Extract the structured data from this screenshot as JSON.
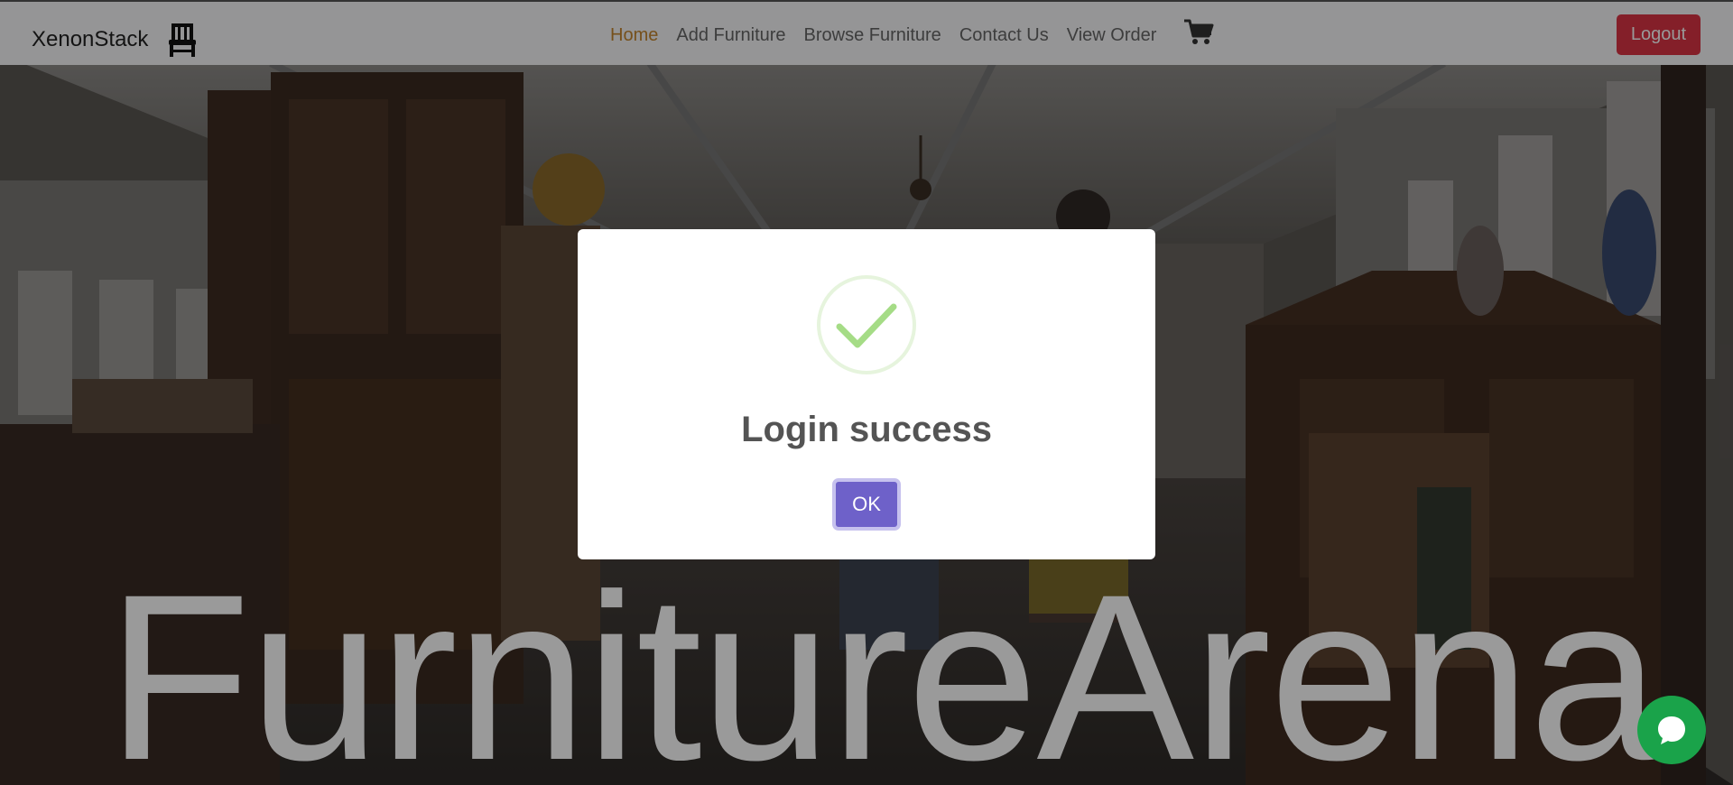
{
  "navbar": {
    "brand": "XenonStack",
    "brand_icon": "chair-icon",
    "links": [
      {
        "label": "Home",
        "active": true
      },
      {
        "label": "Add Furniture",
        "active": false
      },
      {
        "label": "Browse Furniture",
        "active": false
      },
      {
        "label": "Contact Us",
        "active": false
      },
      {
        "label": "View Order",
        "active": false
      }
    ],
    "cart_icon": "cart-icon",
    "logout_label": "Logout"
  },
  "hero": {
    "title": "FurnitureArena"
  },
  "modal": {
    "icon": "success-check-icon",
    "title": "Login success",
    "ok_label": "OK"
  },
  "chat": {
    "icon": "chat-bubble-icon"
  },
  "colors": {
    "active_link": "#c5852e",
    "logout": "#dc3545",
    "ok_button": "#6e61c9",
    "success_check": "#a5dc86",
    "chat_button": "#1aa34a"
  }
}
